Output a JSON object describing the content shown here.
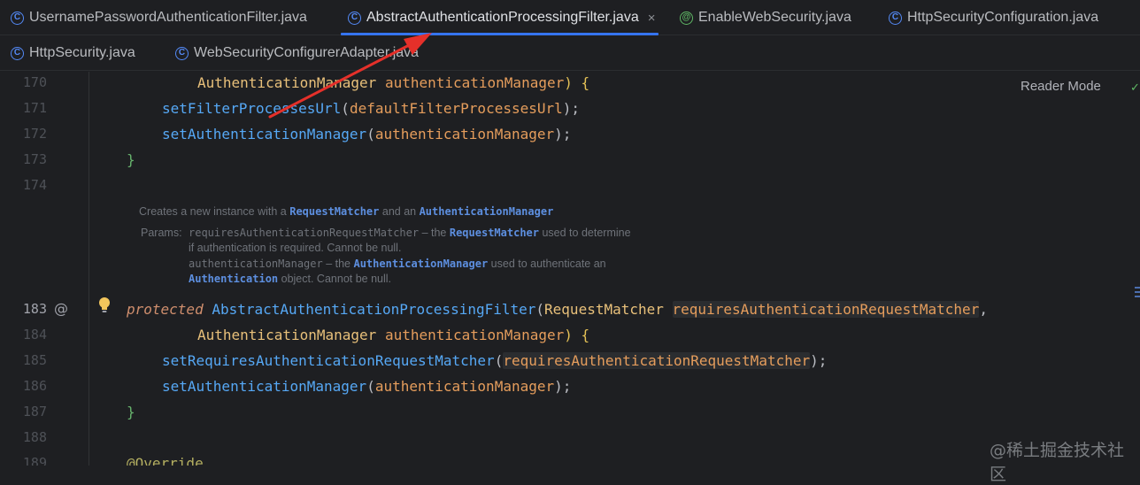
{
  "tabs_row1": [
    {
      "label": "UsernamePasswordAuthenticationFilter.java",
      "icon": "class-icon",
      "active": false
    },
    {
      "label": "AbstractAuthenticationProcessingFilter.java",
      "icon": "class-icon",
      "active": true
    },
    {
      "label": "EnableWebSecurity.java",
      "icon": "annotation-icon",
      "active": false
    },
    {
      "label": "HttpSecurityConfiguration.java",
      "icon": "class-icon",
      "active": false
    }
  ],
  "tabs_row2": [
    {
      "label": "HttpSecurity.java",
      "icon": "class-icon",
      "active": false
    },
    {
      "label": "WebSecurityConfigurerAdapter.java",
      "icon": "class-icon",
      "active": false
    }
  ],
  "icon_glyphs": {
    "class": "C",
    "annotation": "@",
    "close": "×",
    "check": "✓",
    "at": "@"
  },
  "reader_mode": "Reader Mode",
  "line_numbers": [
    "170",
    "171",
    "172",
    "173",
    "174",
    "183",
    "184",
    "185",
    "186",
    "187",
    "188",
    "189"
  ],
  "code": {
    "l170": {
      "type": "AuthenticationManager",
      "param": "authenticationManager",
      "close": ") {"
    },
    "l171": {
      "method": "setFilterProcessesUrl",
      "open": "(",
      "arg": "defaultFilterProcessesUrl",
      "close": ");"
    },
    "l172": {
      "method": "setAuthenticationManager",
      "open": "(",
      "arg": "authenticationManager",
      "close": ");"
    },
    "l173": {
      "brace": "}"
    },
    "l183": {
      "keyword": "protected",
      "method": "AbstractAuthenticationProcessingFilter",
      "open": "(",
      "type": "RequestMatcher",
      "param": "requiresAuthenticationRequestMatcher",
      "comma": ","
    },
    "l184": {
      "type": "AuthenticationManager",
      "param": "authenticationManager",
      "close": ") {"
    },
    "l185": {
      "method": "setRequiresAuthenticationRequestMatcher",
      "open": "(",
      "arg": "requiresAuthenticationRequestMatcher",
      "close": ");"
    },
    "l186": {
      "method": "setAuthenticationManager",
      "open": "(",
      "arg": "authenticationManager",
      "close": ");"
    },
    "l187": {
      "brace": "}"
    },
    "l189": {
      "annotation": "@Override"
    }
  },
  "javadoc": {
    "summary_pre": "Creates a new instance with a ",
    "summary_link1": "RequestMatcher",
    "summary_mid": " and an ",
    "summary_link2": "AuthenticationManager",
    "params_label": "Params:",
    "p1_name": "requiresAuthenticationRequestMatcher",
    "p1_dash": " – the ",
    "p1_link": "RequestMatcher",
    "p1_rest": " used to determine",
    "p1_line2": "if authentication is required. Cannot be null.",
    "p2_name": "authenticationManager",
    "p2_dash": " – the ",
    "p2_link": "AuthenticationManager",
    "p2_rest": " used to authenticate an",
    "p2_line2_link": "Authentication",
    "p2_line2_rest": " object. Cannot be null."
  },
  "watermark": "@稀土掘金技术社区",
  "colors": {
    "accent": "#3574f0",
    "arrow": "#e5302a",
    "method": "#56a8f5",
    "type": "#e8c07a",
    "keyword": "#cf8e6d"
  }
}
